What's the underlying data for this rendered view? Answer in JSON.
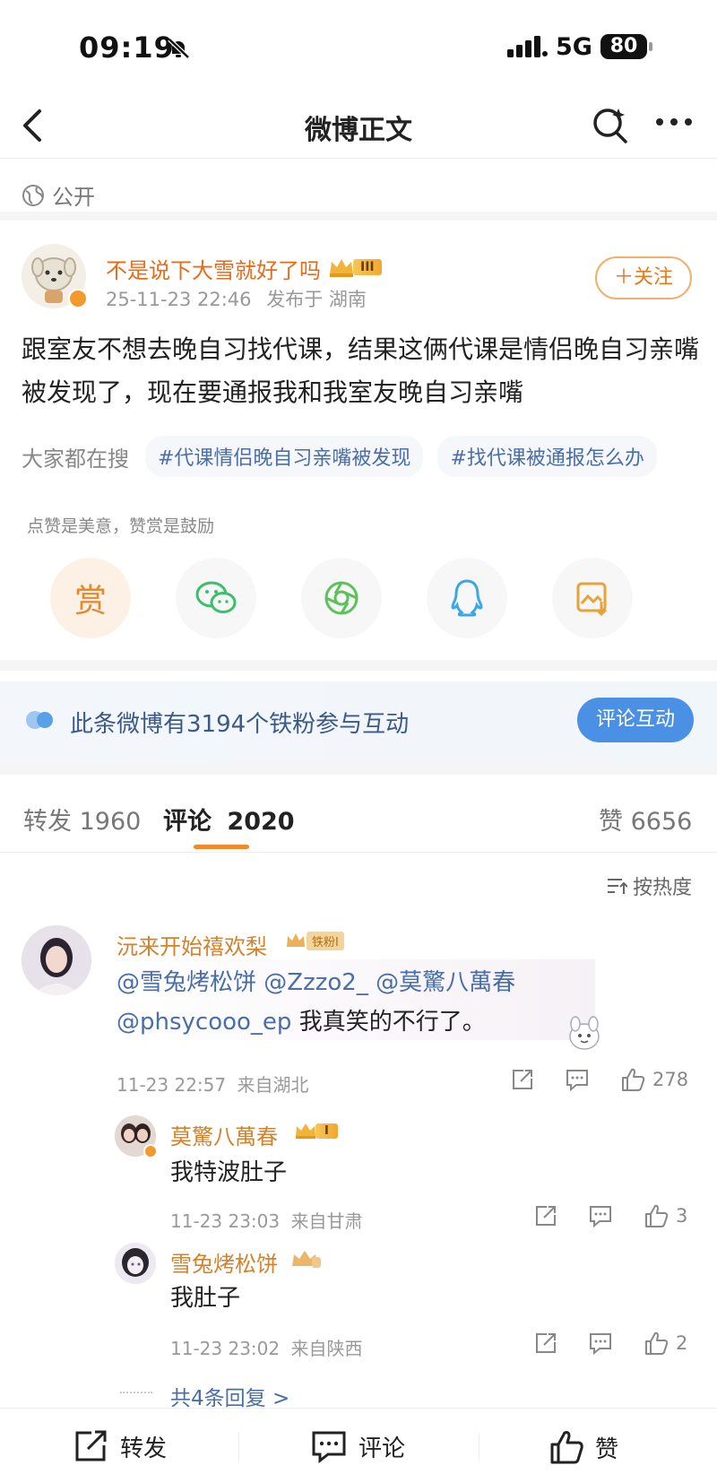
{
  "status_bar": {
    "time": "09:19",
    "network": "5G",
    "battery": "80"
  },
  "nav": {
    "title": "微博正文"
  },
  "visibility": "公开",
  "author": {
    "name": "不是说下大雪就好了吗",
    "badge": "III",
    "time": "25-11-23 22:46",
    "location": "发布于 湖南",
    "follow_label": "＋关注"
  },
  "post": {
    "text": "跟室友不想去晚自习找代课，结果这俩代课是情侣晚自习亲嘴被发现了，现在要通报我和我室友晚自习亲嘴"
  },
  "search": {
    "label": "大家都在搜",
    "chips": [
      "#代课情侣晚自习亲嘴被发现",
      "#找代课被通报怎么办"
    ]
  },
  "reward": {
    "tip": "点赞是美意，赞赏是鼓励",
    "reward_label": "赏",
    "icons": [
      "reward-icon",
      "wechat-icon",
      "moments-icon",
      "qq-icon",
      "save-image-icon"
    ]
  },
  "fans": {
    "text": "此条微博有3194个铁粉参与互动",
    "button": "评论互动"
  },
  "tabs": {
    "repost": "转发 1960",
    "comment_label": "评论",
    "comment_count": "2020",
    "like": "赞 6656"
  },
  "sort_label": "按热度",
  "comments": [
    {
      "name": "沅来开始禧欢梨",
      "badge": "铁粉Ⅰ",
      "mentions": "@雪兔烤松饼 @Zzzo2_ @莫驚八萬春",
      "line2_at": "@phsycooo_ep",
      "line2_text": " 我真笑的不行了。",
      "time": "11-23 22:57",
      "location": "来自湖北",
      "likes": "278"
    }
  ],
  "replies": [
    {
      "name": "莫驚八萬春",
      "badge": "I",
      "text": "我特波肚子",
      "time": "11-23 23:03",
      "location": "来自甘肃",
      "likes": "3"
    },
    {
      "name": "雪兔烤松饼",
      "text": "我肚子",
      "time": "11-23 23:02",
      "location": "来自陕西",
      "likes": "2"
    }
  ],
  "more_replies": "共4条回复 >",
  "bottom": {
    "repost": "转发",
    "comment": "评论",
    "like": "赞"
  },
  "colors": {
    "accent_orange": "#e8791f",
    "link_blue": "#4a6ea8",
    "button_blue": "#4a91e6"
  }
}
